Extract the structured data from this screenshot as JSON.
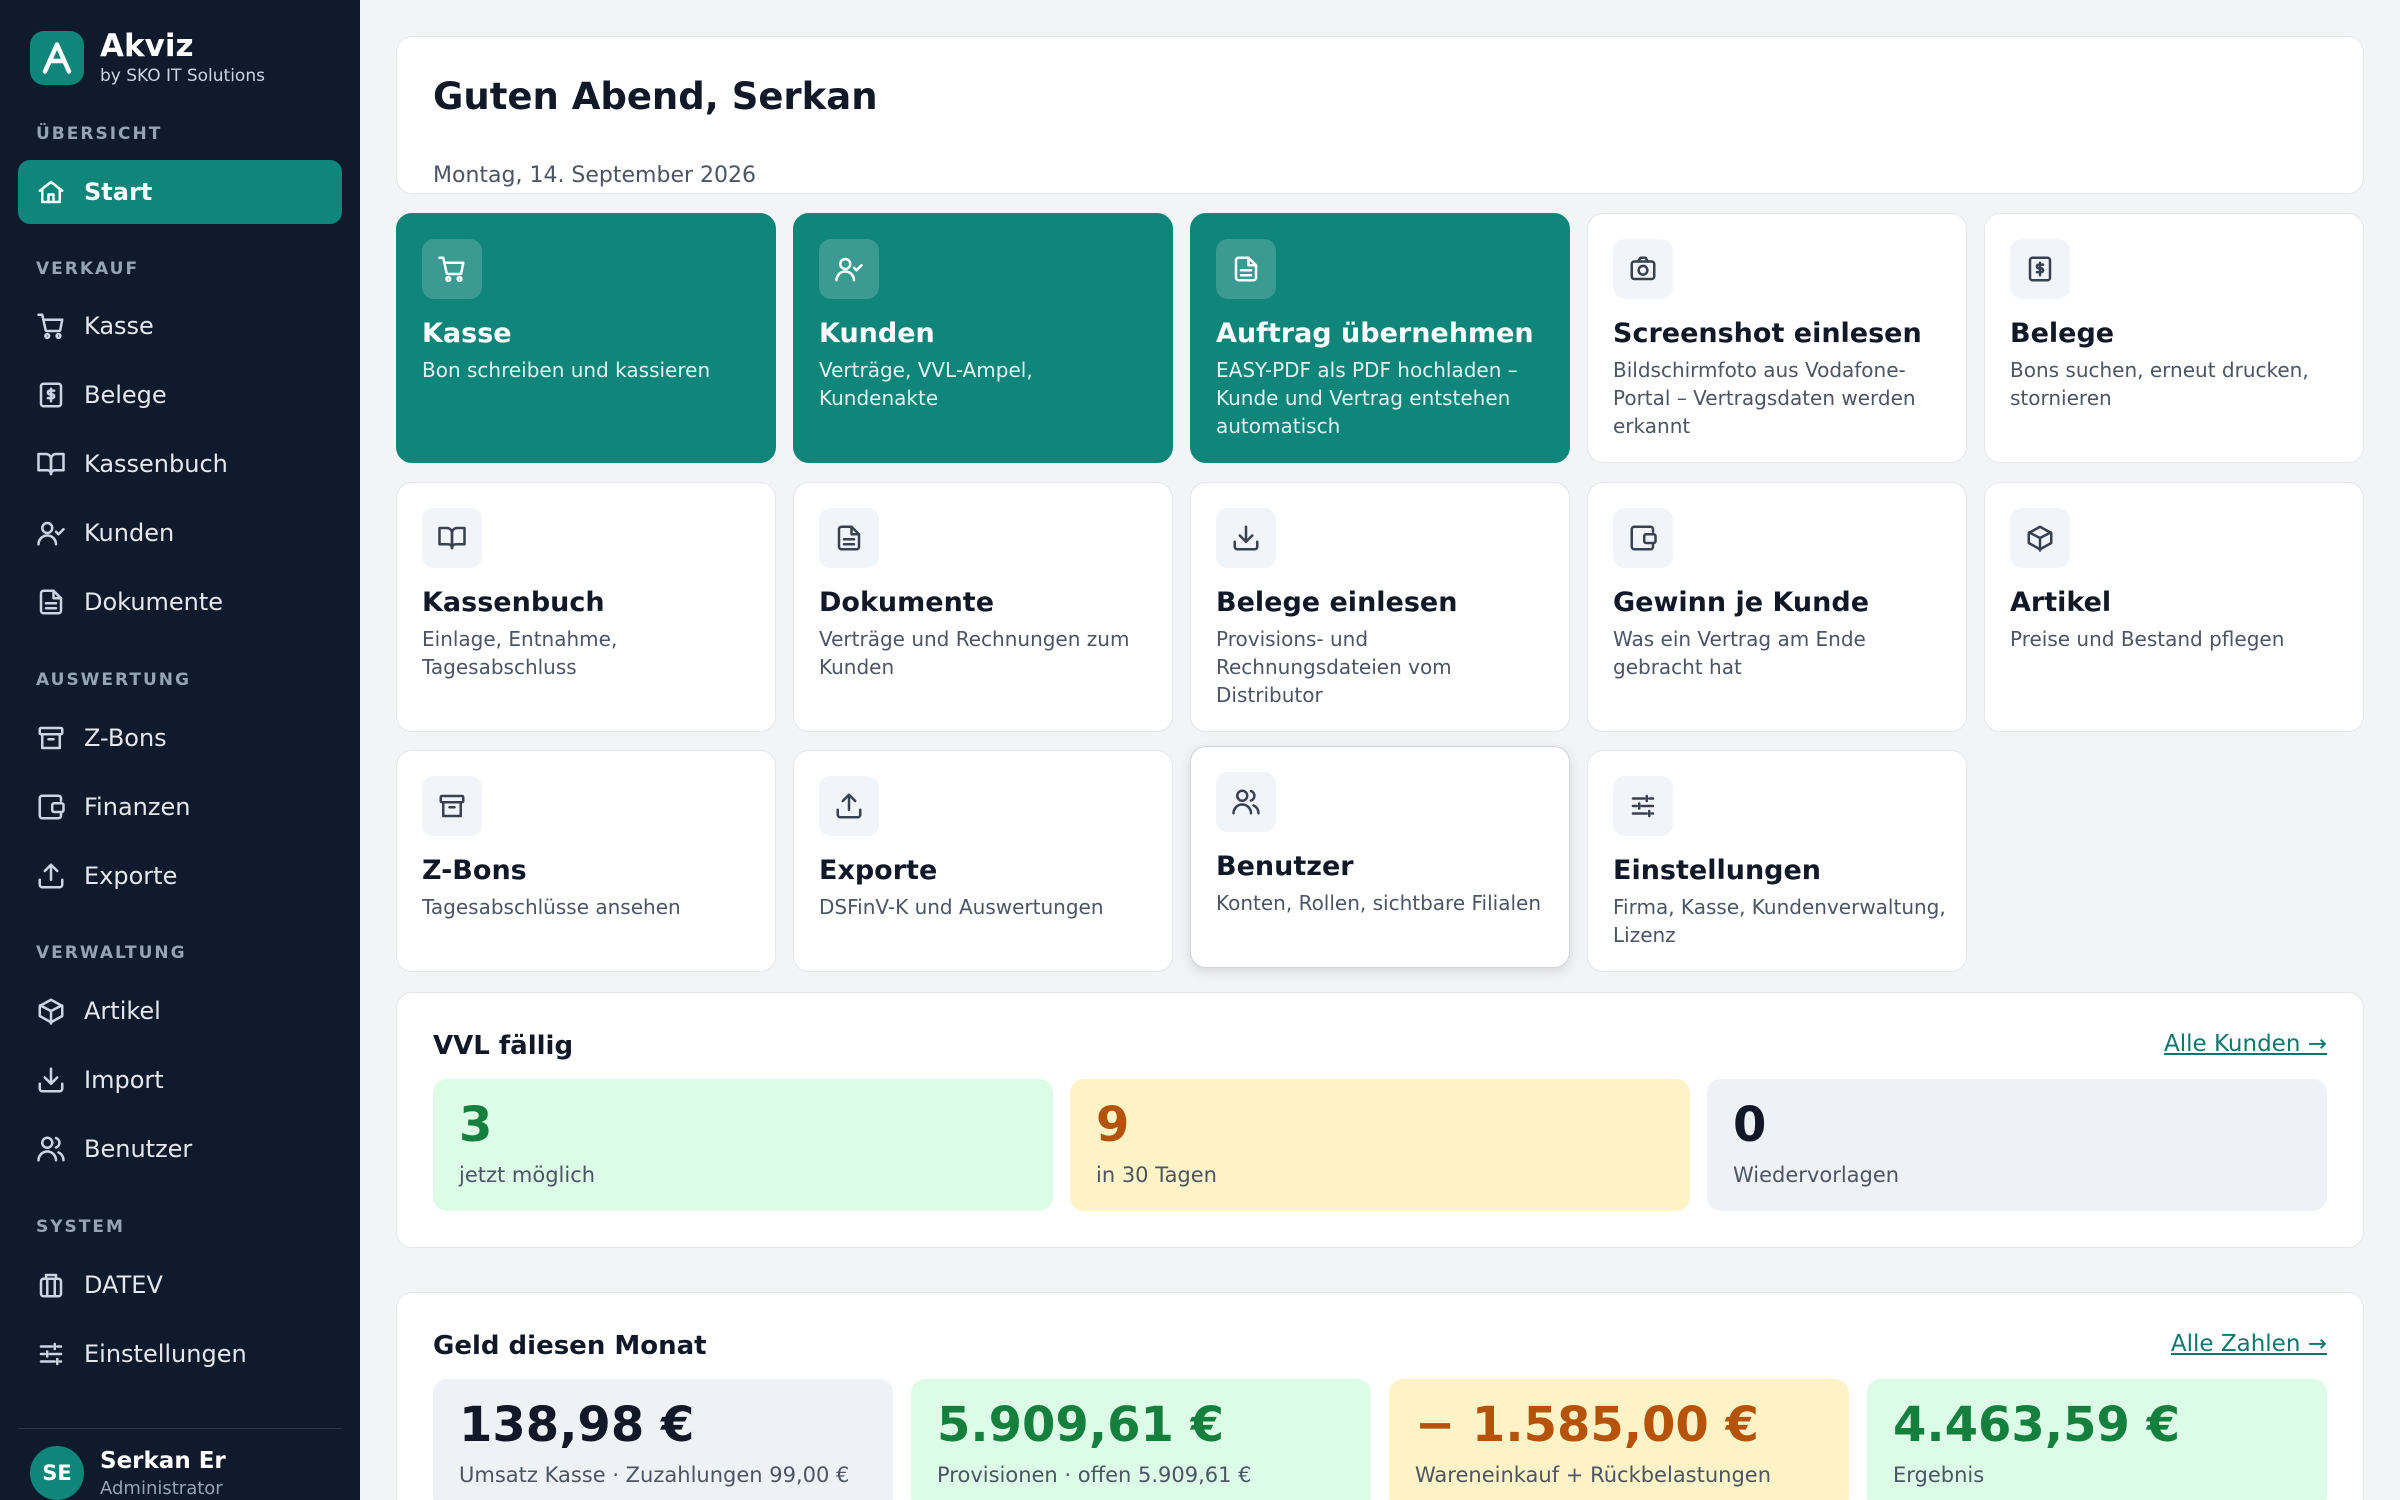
{
  "brand": {
    "name": "Akviz",
    "sub": "by SKO IT Solutions"
  },
  "sidebar": {
    "sections": [
      {
        "label": "ÜBERSICHT",
        "items": [
          {
            "label": "Start",
            "icon": "home-icon",
            "active": true
          }
        ]
      },
      {
        "label": "VERKAUF",
        "items": [
          {
            "label": "Kasse",
            "icon": "cart-icon"
          },
          {
            "label": "Belege",
            "icon": "receipt-icon"
          },
          {
            "label": "Kassenbuch",
            "icon": "book-icon"
          },
          {
            "label": "Kunden",
            "icon": "user-check-icon"
          },
          {
            "label": "Dokumente",
            "icon": "document-icon"
          }
        ]
      },
      {
        "label": "AUSWERTUNG",
        "items": [
          {
            "label": "Z-Bons",
            "icon": "archive-icon"
          },
          {
            "label": "Finanzen",
            "icon": "wallet-icon"
          },
          {
            "label": "Exporte",
            "icon": "upload-icon"
          }
        ]
      },
      {
        "label": "VERWALTUNG",
        "items": [
          {
            "label": "Artikel",
            "icon": "box-icon"
          },
          {
            "label": "Import",
            "icon": "download-icon"
          },
          {
            "label": "Benutzer",
            "icon": "users-icon"
          }
        ]
      },
      {
        "label": "SYSTEM",
        "items": [
          {
            "label": "DATEV",
            "icon": "building-icon"
          },
          {
            "label": "Einstellungen",
            "icon": "sliders-icon"
          }
        ]
      }
    ]
  },
  "user": {
    "initials": "SE",
    "name": "Serkan Er",
    "role": "Administrator"
  },
  "greeting": {
    "title": "Guten Abend, Serkan",
    "date": "Montag, 14. September 2026"
  },
  "tiles": [
    {
      "title": "Kasse",
      "desc": "Bon schreiben und kassieren",
      "icon": "cart-icon",
      "teal": true
    },
    {
      "title": "Kunden",
      "desc": "Verträge, VVL-Ampel, Kundenakte",
      "icon": "user-check-icon",
      "teal": true
    },
    {
      "title": "Auftrag übernehmen",
      "desc": "EASY-PDF als PDF hochladen – Kunde und Vertrag entstehen automatisch",
      "icon": "document-icon",
      "teal": true
    },
    {
      "title": "Screenshot einlesen",
      "desc": "Bildschirmfoto aus Vodafone-Portal – Vertragsdaten werden erkannt",
      "icon": "camera-icon",
      "teal": false
    },
    {
      "title": "Belege",
      "desc": "Bons suchen, erneut drucken, stornieren",
      "icon": "receipt-icon",
      "teal": false
    },
    {
      "title": "Kassenbuch",
      "desc": "Einlage, Entnahme, Tagesabschluss",
      "icon": "book-icon",
      "teal": false
    },
    {
      "title": "Dokumente",
      "desc": "Verträge und Rechnungen zum Kunden",
      "icon": "document-icon",
      "teal": false
    },
    {
      "title": "Belege einlesen",
      "desc": "Provisions- und Rechnungsdateien vom Distributor",
      "icon": "download-icon",
      "teal": false
    },
    {
      "title": "Gewinn je Kunde",
      "desc": "Was ein Vertrag am Ende gebracht hat",
      "icon": "wallet-icon",
      "teal": false
    },
    {
      "title": "Artikel",
      "desc": "Preise und Bestand pflegen",
      "icon": "box-icon",
      "teal": false
    },
    {
      "title": "Z-Bons",
      "desc": "Tagesabschlüsse ansehen",
      "icon": "archive-icon",
      "teal": false
    },
    {
      "title": "Exporte",
      "desc": "DSFinV-K und Auswertungen",
      "icon": "upload-icon",
      "teal": false
    },
    {
      "title": "Benutzer",
      "desc": "Konten, Rollen, sichtbare Filialen",
      "icon": "users-icon",
      "teal": false
    },
    {
      "title": "Einstellungen",
      "desc": "Firma, Kasse, Kundenverwaltung, Lizenz",
      "icon": "sliders-icon",
      "teal": false
    }
  ],
  "vvl": {
    "title": "VVL fällig",
    "link": "Alle Kunden →",
    "stats": [
      {
        "value": "3",
        "label": "jetzt möglich",
        "bg": "#dcfce7",
        "color": "#15803d"
      },
      {
        "value": "9",
        "label": "in 30 Tagen",
        "bg": "#fef3c7",
        "color": "#b45309"
      },
      {
        "value": "0",
        "label": "Wiedervorlagen",
        "bg": "#eef1f5",
        "color": "#111827"
      }
    ]
  },
  "money": {
    "title": "Geld diesen Monat",
    "link": "Alle Zahlen →",
    "stats": [
      {
        "value": "138,98 €",
        "label": "Umsatz Kasse · Zuzahlungen 99,00 €",
        "bg": "#eef1f5",
        "color": "#111827"
      },
      {
        "value": "5.909,61 €",
        "label": "Provisionen · offen 5.909,61 €",
        "bg": "#dcfce7",
        "color": "#15803d"
      },
      {
        "value": "− 1.585,00 €",
        "label": "Wareneinkauf + Rückbelastungen",
        "bg": "#fef3c7",
        "color": "#b45309"
      },
      {
        "value": "4.463,59 €",
        "label": "Ergebnis",
        "bg": "#dcfce7",
        "color": "#15803d"
      }
    ]
  },
  "colors": {
    "accent": "#10857a",
    "sidebar": "#0f1b2d"
  }
}
